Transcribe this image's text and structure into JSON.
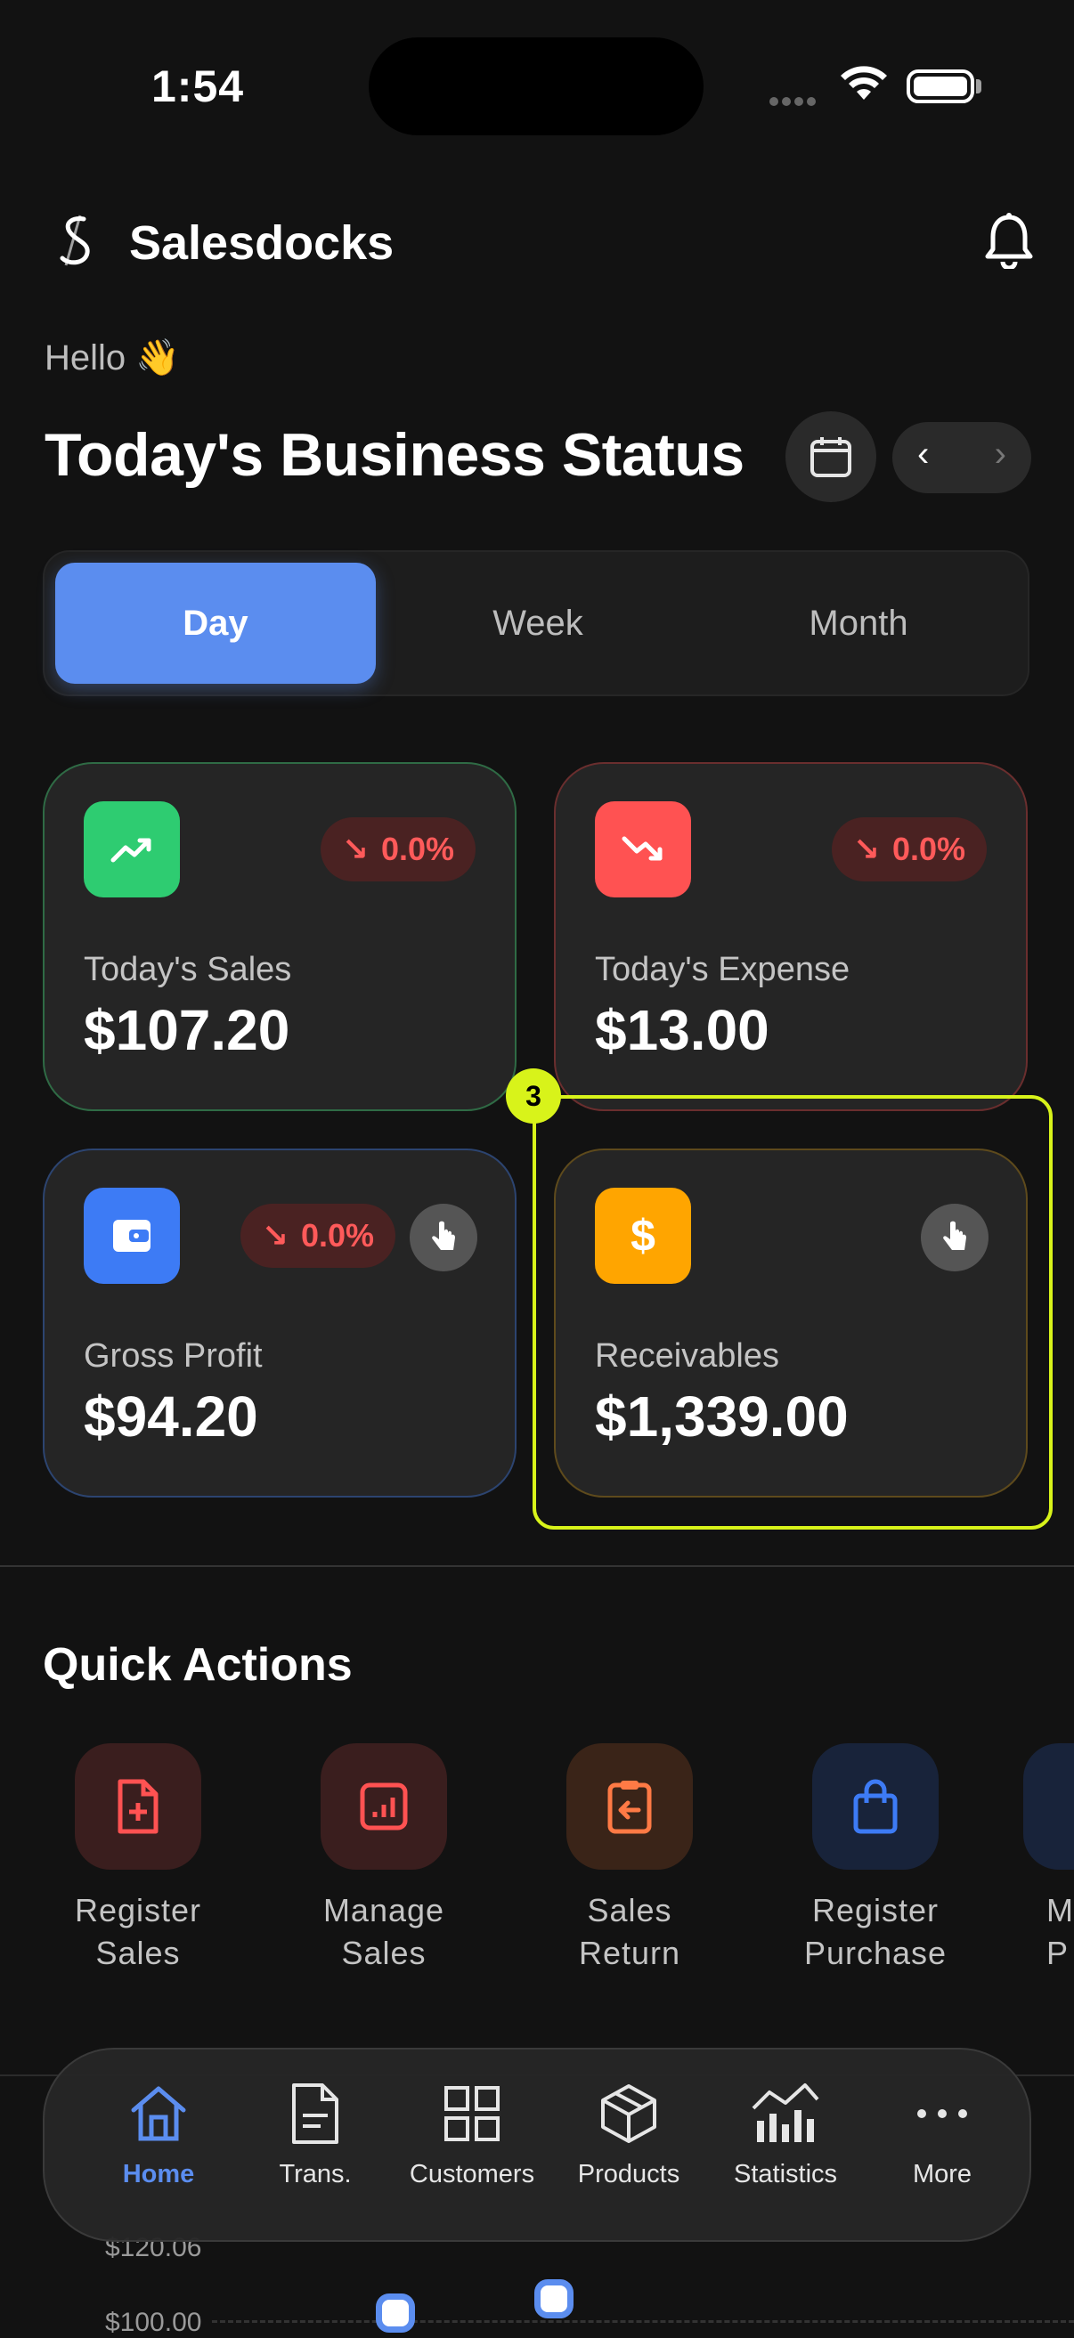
{
  "status_bar": {
    "time": "1:54"
  },
  "header": {
    "app_name": "Salesdocks"
  },
  "greeting": "Hello 👋",
  "page_title": "Today's Business Status",
  "period_tabs": [
    {
      "label": "Day",
      "active": true
    },
    {
      "label": "Week",
      "active": false
    },
    {
      "label": "Month",
      "active": false
    }
  ],
  "cards": {
    "sales": {
      "label": "Today's Sales",
      "value": "$107.20",
      "change": "0.0%",
      "icon": "trending-up-icon",
      "color": "#2ecc71"
    },
    "expense": {
      "label": "Today's Expense",
      "value": "$13.00",
      "change": "0.0%",
      "icon": "trending-down-icon",
      "color": "#ff5252"
    },
    "gross_profit": {
      "label": "Gross Profit",
      "value": "$94.20",
      "change": "0.0%",
      "icon": "wallet-icon",
      "color": "#3d7bf5"
    },
    "receivables": {
      "label": "Receivables",
      "value": "$1,339.00",
      "icon": "dollar-icon",
      "color": "#ffa500"
    }
  },
  "highlight_number": "3",
  "quick_actions": {
    "title": "Quick Actions",
    "items": [
      {
        "label": "Register Sales",
        "icon": "file-plus-icon"
      },
      {
        "label": "Manage Sales",
        "icon": "report-icon"
      },
      {
        "label": "Sales Return",
        "icon": "return-icon"
      },
      {
        "label": "Register Purchase",
        "icon": "shopping-bag-icon"
      },
      {
        "label": "M P",
        "icon": "partial-icon"
      }
    ]
  },
  "chart_preview": {
    "y_labels": [
      "$120.06",
      "$100.00"
    ]
  },
  "bottom_nav": [
    {
      "label": "Home",
      "icon": "home-icon",
      "active": true
    },
    {
      "label": "Trans.",
      "icon": "document-icon",
      "active": false
    },
    {
      "label": "Customers",
      "icon": "grid-icon",
      "active": false
    },
    {
      "label": "Products",
      "icon": "cube-icon",
      "active": false
    },
    {
      "label": "Statistics",
      "icon": "chart-icon",
      "active": false
    },
    {
      "label": "More",
      "icon": "more-icon",
      "active": false
    }
  ]
}
